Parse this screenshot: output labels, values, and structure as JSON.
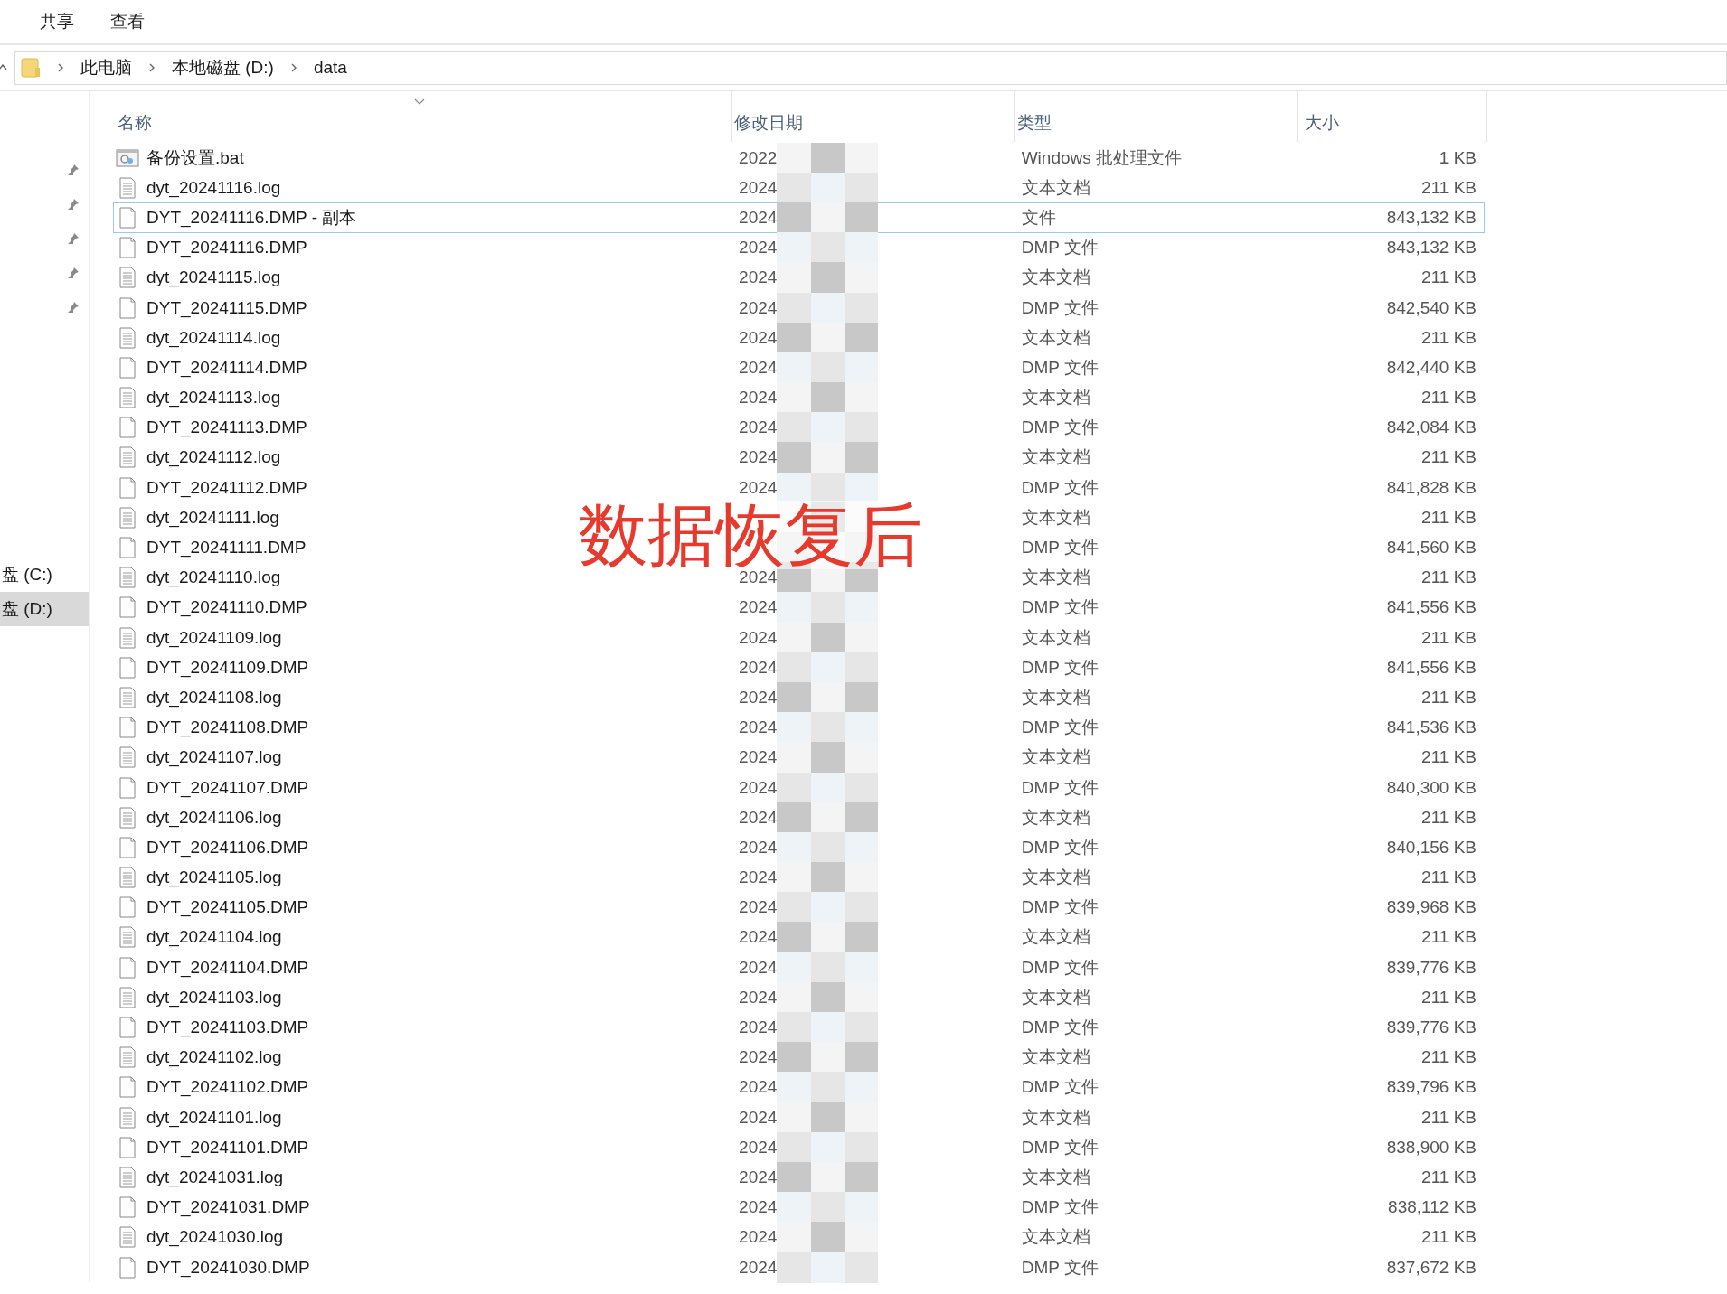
{
  "menu": [
    {
      "label": "共享"
    },
    {
      "label": "查看"
    }
  ],
  "address": {
    "crumbs": [
      "此电脑",
      "本地磁盘 (D:)",
      "data"
    ]
  },
  "nav": {
    "drives": [
      {
        "label": "盘 (C:)",
        "selected": false
      },
      {
        "label": "盘 (D:)",
        "selected": true
      }
    ]
  },
  "columns": [
    "名称",
    "修改日期",
    "类型",
    "大小"
  ],
  "rows": [
    {
      "kind": "bat",
      "name": "备份设置.bat",
      "date": "2022",
      "type": "Windows 批处理文件",
      "size": "1 KB",
      "selected": false
    },
    {
      "kind": "log",
      "name": "dyt_20241116.log",
      "date": "2024",
      "type": "文本文档",
      "size": "211 KB",
      "selected": false
    },
    {
      "kind": "dmp",
      "name": "DYT_20241116.DMP - 副本",
      "date": "2024",
      "type": "文件",
      "size": "843,132 KB",
      "selected": true
    },
    {
      "kind": "dmp",
      "name": "DYT_20241116.DMP",
      "date": "2024",
      "type": "DMP 文件",
      "size": "843,132 KB",
      "selected": false
    },
    {
      "kind": "log",
      "name": "dyt_20241115.log",
      "date": "2024",
      "type": "文本文档",
      "size": "211 KB",
      "selected": false
    },
    {
      "kind": "dmp",
      "name": "DYT_20241115.DMP",
      "date": "2024",
      "type": "DMP 文件",
      "size": "842,540 KB",
      "selected": false
    },
    {
      "kind": "log",
      "name": "dyt_20241114.log",
      "date": "2024",
      "type": "文本文档",
      "size": "211 KB",
      "selected": false
    },
    {
      "kind": "dmp",
      "name": "DYT_20241114.DMP",
      "date": "2024",
      "type": "DMP 文件",
      "size": "842,440 KB",
      "selected": false
    },
    {
      "kind": "log",
      "name": "dyt_20241113.log",
      "date": "2024",
      "type": "文本文档",
      "size": "211 KB",
      "selected": false
    },
    {
      "kind": "dmp",
      "name": "DYT_20241113.DMP",
      "date": "2024",
      "type": "DMP 文件",
      "size": "842,084 KB",
      "selected": false
    },
    {
      "kind": "log",
      "name": "dyt_20241112.log",
      "date": "2024",
      "type": "文本文档",
      "size": "211 KB",
      "selected": false
    },
    {
      "kind": "dmp",
      "name": "DYT_20241112.DMP",
      "date": "2024",
      "type": "DMP 文件",
      "size": "841,828 KB",
      "selected": false
    },
    {
      "kind": "log",
      "name": "dyt_20241111.log",
      "type": "文本文档",
      "size": "211 KB",
      "selected": false
    },
    {
      "kind": "dmp",
      "name": "DYT_20241111.DMP",
      "type": "DMP 文件",
      "size": "841,560 KB",
      "selected": false
    },
    {
      "kind": "log",
      "name": "dyt_20241110.log",
      "date": "2024",
      "type": "文本文档",
      "size": "211 KB",
      "selected": false
    },
    {
      "kind": "dmp",
      "name": "DYT_20241110.DMP",
      "date": "2024",
      "type": "DMP 文件",
      "size": "841,556 KB",
      "selected": false
    },
    {
      "kind": "log",
      "name": "dyt_20241109.log",
      "date": "2024",
      "type": "文本文档",
      "size": "211 KB",
      "selected": false
    },
    {
      "kind": "dmp",
      "name": "DYT_20241109.DMP",
      "date": "2024",
      "type": "DMP 文件",
      "size": "841,556 KB",
      "selected": false
    },
    {
      "kind": "log",
      "name": "dyt_20241108.log",
      "date": "2024",
      "type": "文本文档",
      "size": "211 KB",
      "selected": false
    },
    {
      "kind": "dmp",
      "name": "DYT_20241108.DMP",
      "date": "2024",
      "type": "DMP 文件",
      "size": "841,536 KB",
      "selected": false
    },
    {
      "kind": "log",
      "name": "dyt_20241107.log",
      "date": "2024",
      "type": "文本文档",
      "size": "211 KB",
      "selected": false
    },
    {
      "kind": "dmp",
      "name": "DYT_20241107.DMP",
      "date": "2024",
      "type": "DMP 文件",
      "size": "840,300 KB",
      "selected": false
    },
    {
      "kind": "log",
      "name": "dyt_20241106.log",
      "date": "2024",
      "type": "文本文档",
      "size": "211 KB",
      "selected": false
    },
    {
      "kind": "dmp",
      "name": "DYT_20241106.DMP",
      "date": "2024",
      "type": "DMP 文件",
      "size": "840,156 KB",
      "selected": false
    },
    {
      "kind": "log",
      "name": "dyt_20241105.log",
      "date": "2024",
      "type": "文本文档",
      "size": "211 KB",
      "selected": false
    },
    {
      "kind": "dmp",
      "name": "DYT_20241105.DMP",
      "date": "2024",
      "type": "DMP 文件",
      "size": "839,968 KB",
      "selected": false
    },
    {
      "kind": "log",
      "name": "dyt_20241104.log",
      "date": "2024",
      "type": "文本文档",
      "size": "211 KB",
      "selected": false
    },
    {
      "kind": "dmp",
      "name": "DYT_20241104.DMP",
      "date": "2024",
      "type": "DMP 文件",
      "size": "839,776 KB",
      "selected": false
    },
    {
      "kind": "log",
      "name": "dyt_20241103.log",
      "date": "2024",
      "type": "文本文档",
      "size": "211 KB",
      "selected": false
    },
    {
      "kind": "dmp",
      "name": "DYT_20241103.DMP",
      "date": "2024",
      "type": "DMP 文件",
      "size": "839,776 KB",
      "selected": false
    },
    {
      "kind": "log",
      "name": "dyt_20241102.log",
      "date": "2024",
      "type": "文本文档",
      "size": "211 KB",
      "selected": false
    },
    {
      "kind": "dmp",
      "name": "DYT_20241102.DMP",
      "date": "2024",
      "type": "DMP 文件",
      "size": "839,796 KB",
      "selected": false
    },
    {
      "kind": "log",
      "name": "dyt_20241101.log",
      "date": "2024",
      "type": "文本文档",
      "size": "211 KB",
      "selected": false
    },
    {
      "kind": "dmp",
      "name": "DYT_20241101.DMP",
      "date": "2024",
      "type": "DMP 文件",
      "size": "838,900 KB",
      "selected": false
    },
    {
      "kind": "log",
      "name": "dyt_20241031.log",
      "date": "2024",
      "type": "文本文档",
      "size": "211 KB",
      "selected": false
    },
    {
      "kind": "dmp",
      "name": "DYT_20241031.DMP",
      "date": "2024",
      "type": "DMP 文件",
      "size": "838,112 KB",
      "selected": false
    },
    {
      "kind": "log",
      "name": "dyt_20241030.log",
      "date": "2024",
      "type": "文本文档",
      "size": "211 KB",
      "selected": false
    },
    {
      "kind": "dmp",
      "name": "DYT_20241030.DMP",
      "date": "2024",
      "type": "DMP 文件",
      "size": "837,672 KB",
      "selected": false
    }
  ],
  "overlay_caption": "数据恢复后"
}
